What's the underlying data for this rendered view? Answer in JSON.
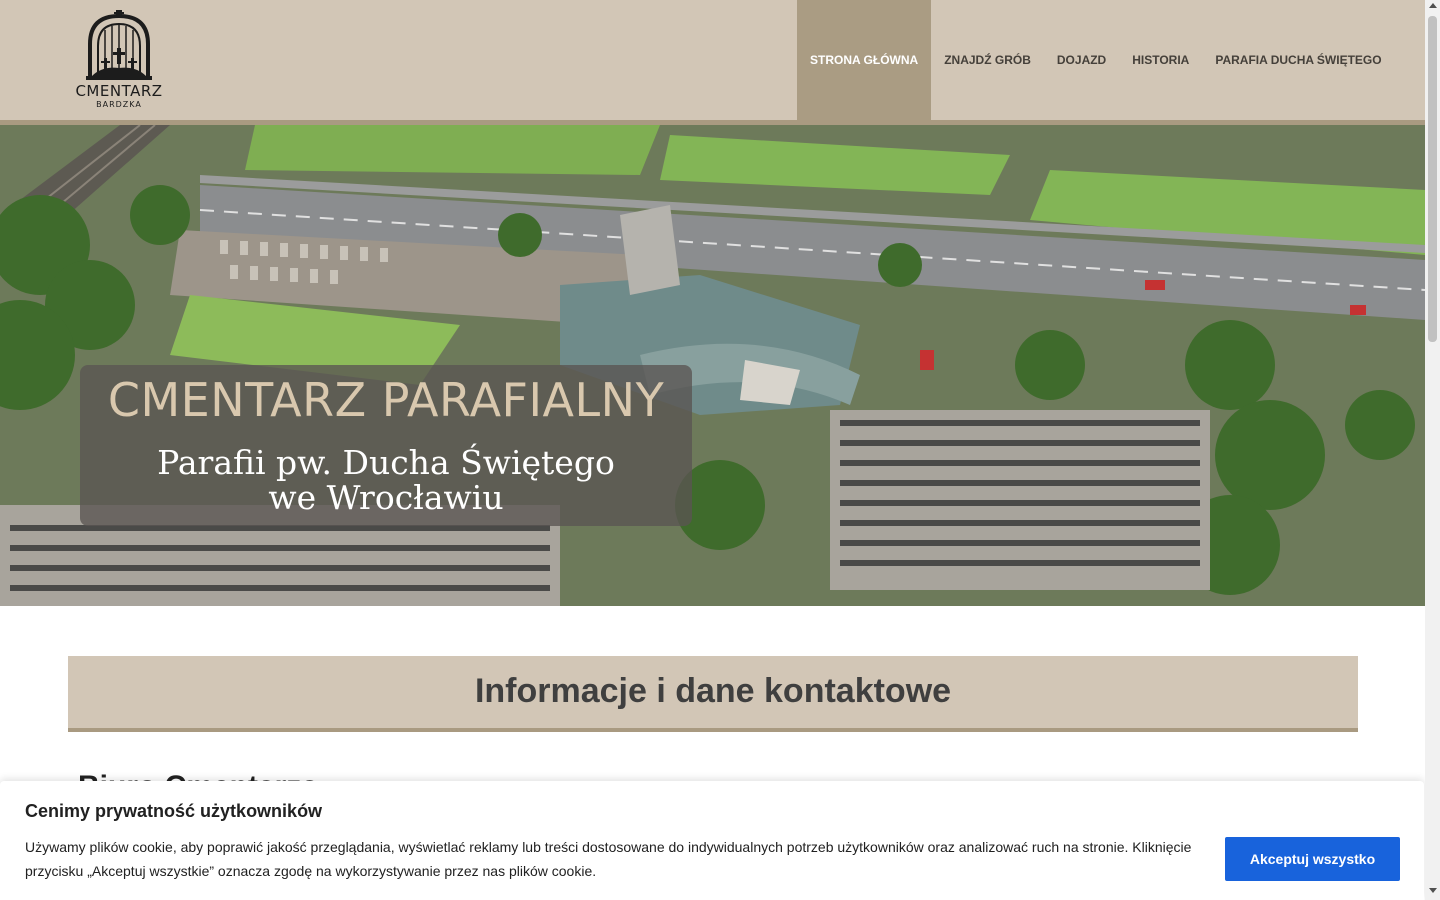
{
  "logo": {
    "title": "CMENTARZ",
    "subtitle": "BARDZKA",
    "icon": "cemetery-gate-icon"
  },
  "nav": {
    "items": [
      {
        "label": "STRONA GŁÓWNA",
        "active": true
      },
      {
        "label": "ZNAJDŹ GRÓB",
        "active": false
      },
      {
        "label": "DOJAZD",
        "active": false
      },
      {
        "label": "HISTORIA",
        "active": false
      },
      {
        "label": "PARAFIA DUCHA ŚWIĘTEGO",
        "active": false
      }
    ]
  },
  "hero": {
    "title": "CMENTARZ PARAFIALNY",
    "subtitle": "Parafii pw. Ducha Świętego we Wrocławiu"
  },
  "info": {
    "title": "Informacje i dane kontaktowe"
  },
  "peek": {
    "heading": "Biuro Cmentarza"
  },
  "cookie": {
    "title": "Cenimy prywatność użytkowników",
    "text": "Używamy plików cookie, aby poprawić jakość przeglądania, wyświetlać reklamy lub treści dostosowane do indywidualnych potrzeb użytkowników oraz analizować ruch na stronie. Kliknięcie przycisku „Akceptuj wszystkie” oznacza zgodę na wykorzystywanie przez nas plików cookie.",
    "accept_label": "Akceptuj wszystko"
  },
  "colors": {
    "header_bg": "#d2c6b6",
    "nav_active_bg": "#aa9c83",
    "accent_border": "#a99a81",
    "cookie_button": "#1863dc"
  }
}
